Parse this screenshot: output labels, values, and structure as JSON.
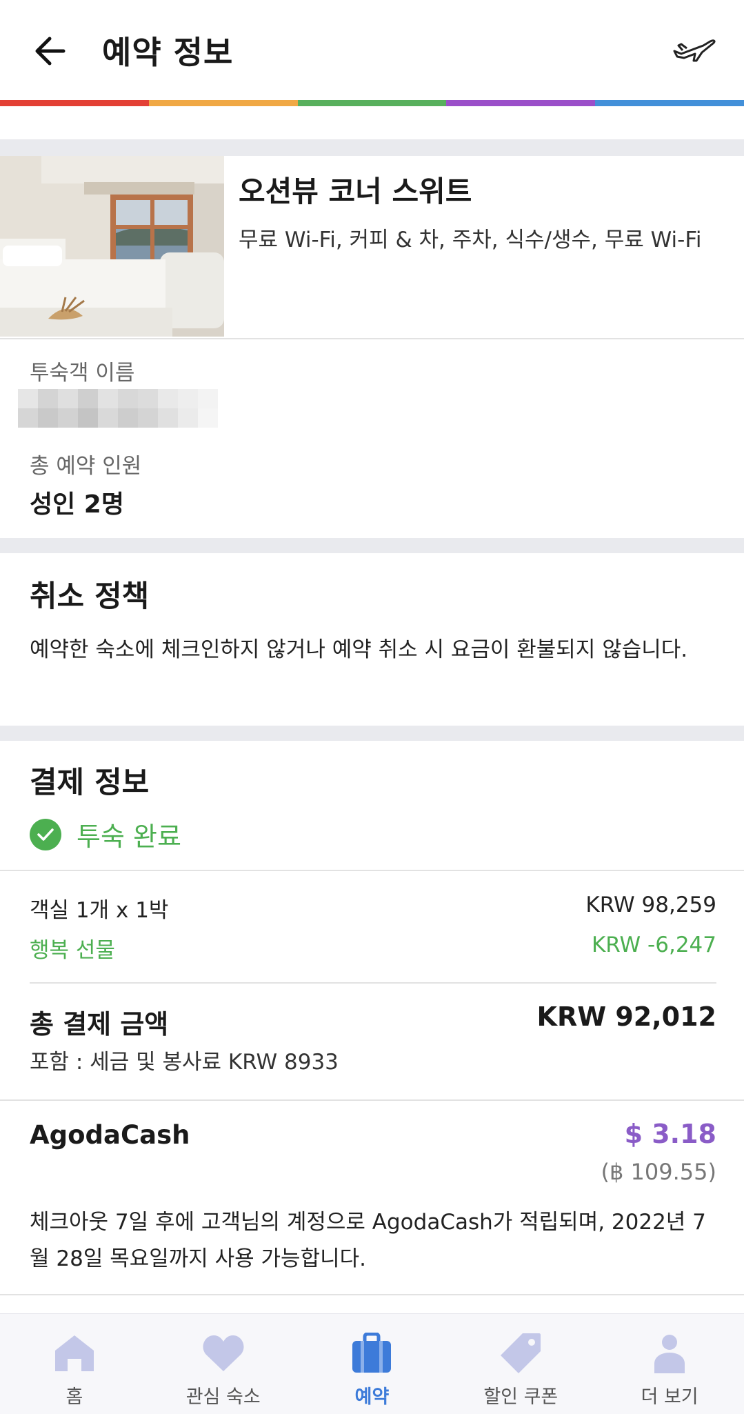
{
  "header": {
    "title": "예약 정보",
    "colors": [
      "#e34035",
      "#f0a845",
      "#58b05d",
      "#9b4fc9",
      "#4390d9"
    ]
  },
  "room": {
    "name": "오션뷰 코너 스위트",
    "amenities": "무료 Wi-Fi, 커피 & 차, 주차, 식수/생수, 무료 Wi-Fi"
  },
  "guest": {
    "name_label": "투숙객 이름",
    "count_label": "총 예약 인원",
    "count_value": "성인 2명"
  },
  "policy": {
    "title": "취소 정책",
    "text": "예약한 숙소에 체크인하지 않거나 예약 취소 시 요금이 환불되지 않습니다."
  },
  "payment": {
    "title": "결제 정보",
    "status": "투숙 완료",
    "room_line_label": "객실 1개 x 1박",
    "room_line_value": "KRW 98,259",
    "gift_label": "행복 선물",
    "gift_value": "KRW -6,247",
    "total_label": "총 결제 금액",
    "total_value": "KRW 92,012",
    "tax_note": "포함 : 세금 및 봉사료 KRW 8933"
  },
  "agodacash": {
    "label": "AgodaCash",
    "usd": "$ 3.18",
    "thb": "(฿ 109.55)",
    "note": "체크아웃 7일 후에 고객님의 계정으로 AgodaCash가 적립되며, 2022년 7월 28일 목요일까지 사용 가능합니다."
  },
  "nav": {
    "items": [
      {
        "label": "홈",
        "icon": "home-icon"
      },
      {
        "label": "관심 숙소",
        "icon": "heart-icon"
      },
      {
        "label": "예약",
        "icon": "briefcase-icon"
      },
      {
        "label": "할인 쿠폰",
        "icon": "tag-icon"
      },
      {
        "label": "더 보기",
        "icon": "person-icon"
      }
    ],
    "active_color": "#3d7bd9",
    "inactive_color": "#c3c7e8"
  }
}
